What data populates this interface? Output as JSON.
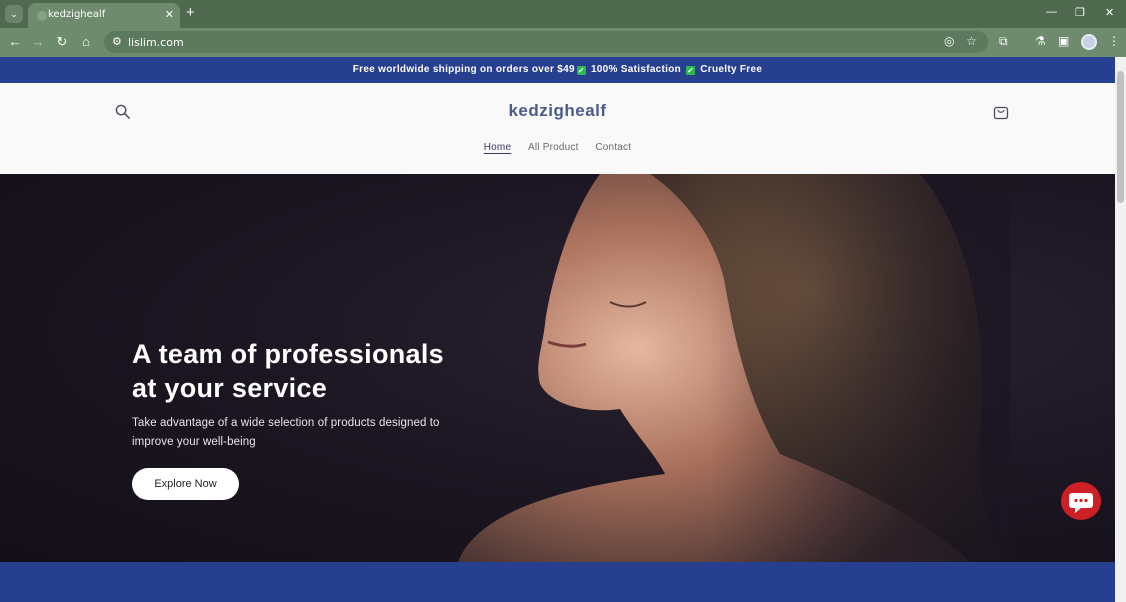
{
  "browser": {
    "tab": {
      "title": "kedzighealf"
    },
    "url": "lislim.com"
  },
  "announcement": {
    "part1": "Free worldwide shipping on orders over $49",
    "part2": "100% Satisfaction",
    "part3": "Cruelty Free"
  },
  "header": {
    "brand": "kedzighealf",
    "nav": [
      {
        "label": "Home",
        "active": true
      },
      {
        "label": "All Product",
        "active": false
      },
      {
        "label": "Contact",
        "active": false
      }
    ]
  },
  "hero": {
    "title": "A team of professionals at your service",
    "subtitle": "Take advantage of a wide selection of products designed to improve your well-being",
    "button": "Explore Now"
  },
  "colors": {
    "announcement_bg": "#273f8f",
    "brand_text": "#4b5b8a",
    "hero_bg": "#1a1520",
    "chat_bubble": "#cc1f26",
    "chrome": "#6e8b6e"
  }
}
